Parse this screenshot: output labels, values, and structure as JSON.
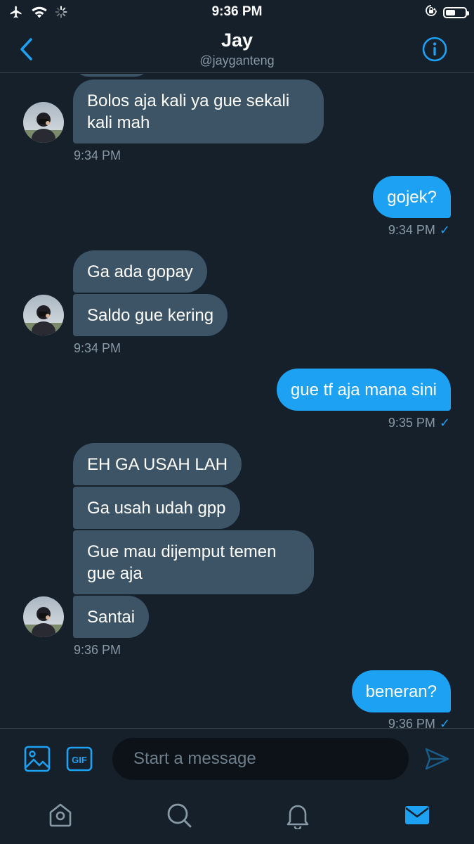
{
  "status_bar": {
    "time": "9:36 PM"
  },
  "header": {
    "name": "Jay",
    "handle": "@jayganteng"
  },
  "messages": [
    {
      "id": "m1",
      "direction": "incoming",
      "text": "Bolos aja kali ya gue sekali\nkali mah"
    },
    {
      "id": "t1",
      "type": "timestamp",
      "text": "9:34 PM"
    },
    {
      "id": "m2",
      "direction": "outgoing",
      "text": "gojek?"
    },
    {
      "id": "t2",
      "type": "timestamp",
      "text": "9:34 PM",
      "read": true
    },
    {
      "id": "m3",
      "direction": "incoming",
      "text": "Ga ada gopay"
    },
    {
      "id": "m4",
      "direction": "incoming",
      "text": "Saldo gue kering"
    },
    {
      "id": "t3",
      "type": "timestamp",
      "text": "9:34 PM"
    },
    {
      "id": "m5",
      "direction": "outgoing",
      "text": "gue tf aja mana sini"
    },
    {
      "id": "t4",
      "type": "timestamp",
      "text": "9:35 PM",
      "read": true
    },
    {
      "id": "m6",
      "direction": "incoming",
      "text": "EH GA USAH LAH"
    },
    {
      "id": "m7",
      "direction": "incoming",
      "text": "Ga usah udah gpp"
    },
    {
      "id": "m8",
      "direction": "incoming",
      "text": "Gue mau dijemput temen\ngue aja"
    },
    {
      "id": "m9",
      "direction": "incoming",
      "text": "Santai"
    },
    {
      "id": "t5",
      "type": "timestamp",
      "text": "9:36 PM"
    },
    {
      "id": "m10",
      "direction": "outgoing",
      "text": "beneran?"
    },
    {
      "id": "t6",
      "type": "timestamp",
      "text": "9:36 PM",
      "read": true
    }
  ],
  "composer": {
    "placeholder": "Start a message",
    "gif_label": "GIF"
  },
  "tabs": [
    {
      "name": "home",
      "icon": "home-icon",
      "active": false
    },
    {
      "name": "search",
      "icon": "search-icon",
      "active": false
    },
    {
      "name": "notifications",
      "icon": "bell-icon",
      "active": false
    },
    {
      "name": "messages",
      "icon": "mail-icon",
      "active": true
    }
  ],
  "colors": {
    "background": "#15202b",
    "accent": "#1da1f2",
    "incoming_bubble": "#3d5466",
    "secondary_text": "#8899a6",
    "divider": "#38444d"
  }
}
